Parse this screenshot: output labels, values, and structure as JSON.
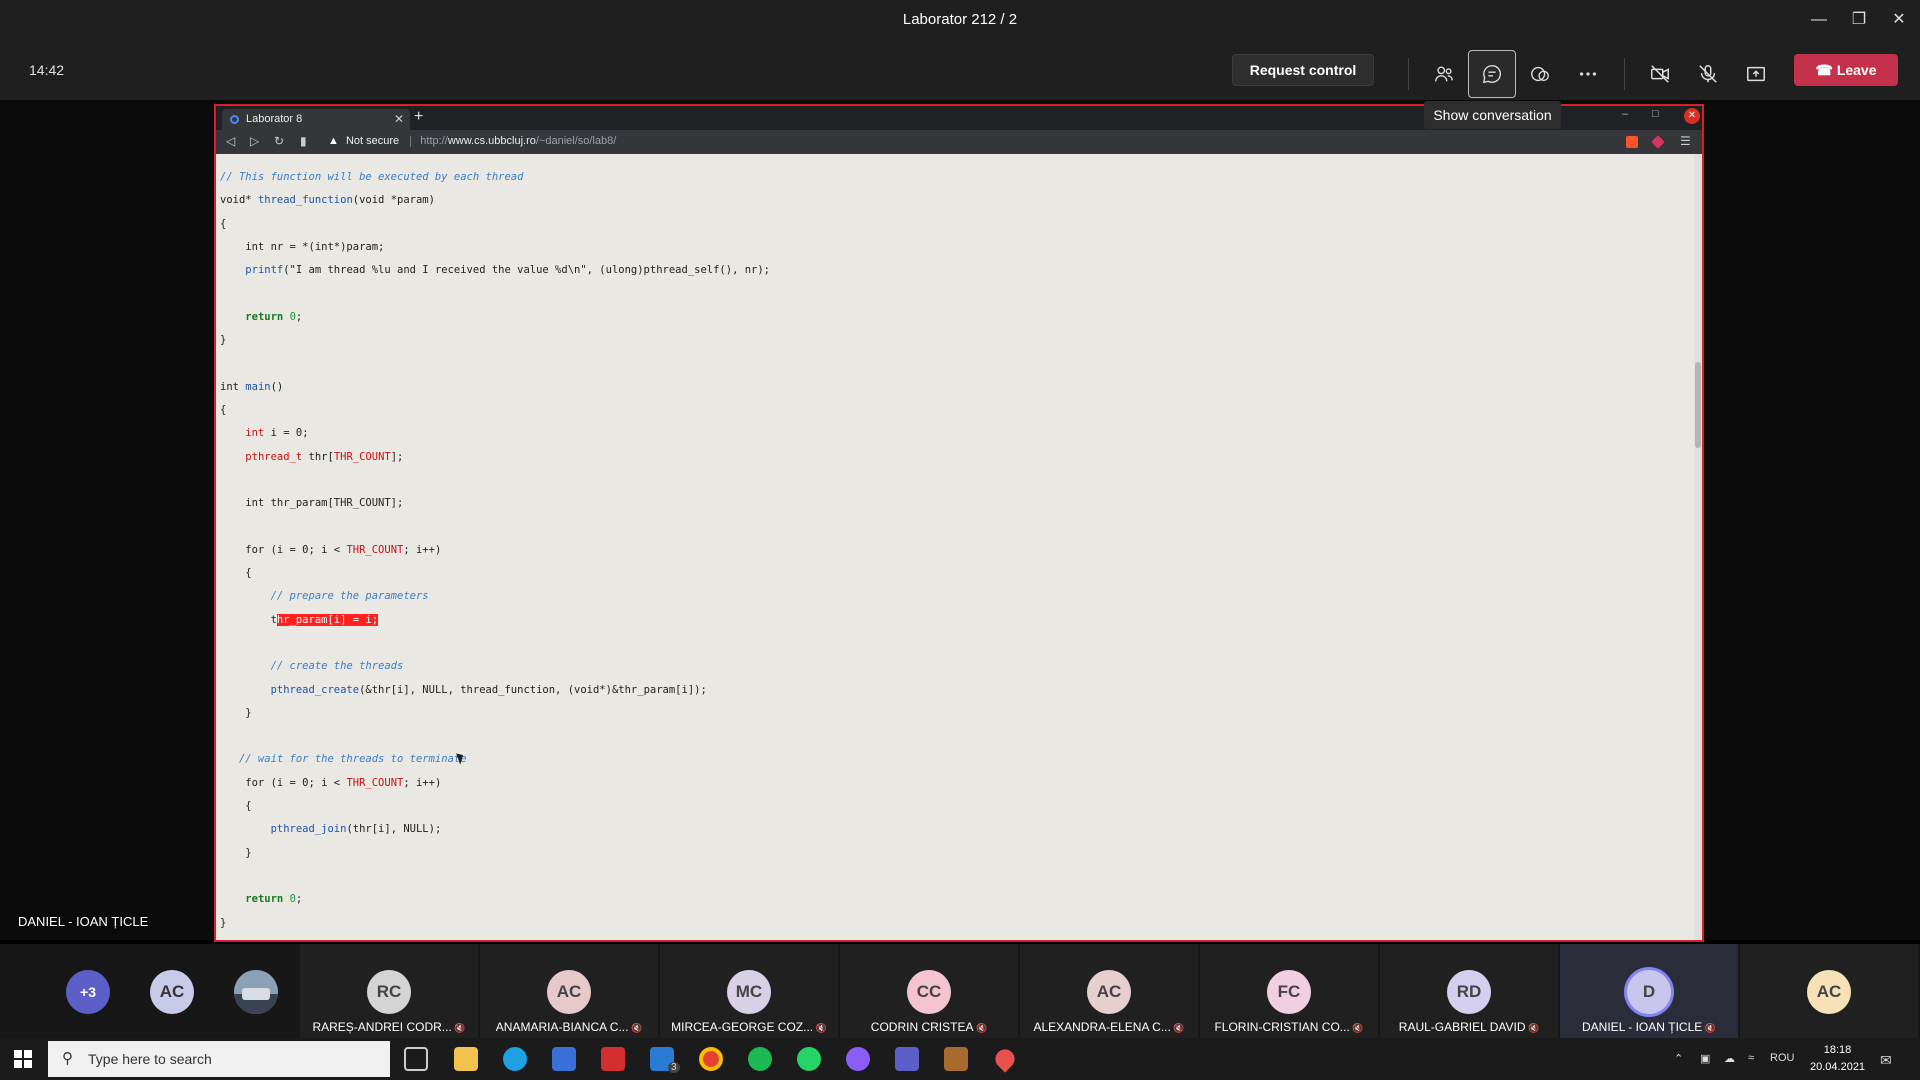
{
  "window": {
    "title": "Laborator 212 / 2"
  },
  "meeting": {
    "timer": "14:42",
    "request_control_label": "Request control",
    "leave_label": "Leave",
    "tooltip": "Show conversation",
    "presenter_name": "DANIEL - IOAN ȚICLE"
  },
  "browser": {
    "tab_title": "Laborator 8",
    "not_secure_label": "Not secure",
    "url_prefix": "http://",
    "url_host": "www.cs.ubbcluj.ro",
    "url_path": "/~daniel/so/lab8/"
  },
  "participants": {
    "overflow_count": "+3",
    "small_avatar_initials": "AC",
    "tiles": [
      {
        "initials": "RC",
        "name": "RAREȘ-ANDREI CODR...",
        "color": "#d4d4d4"
      },
      {
        "initials": "AC",
        "name": "ANAMARIA-BIANCA C...",
        "color": "#e8c9c9"
      },
      {
        "initials": "MC",
        "name": "MIRCEA-GEORGE COZ...",
        "color": "#d7d0e7"
      },
      {
        "initials": "CC",
        "name": "CODRIN CRISTEA",
        "color": "#f4c5d1"
      },
      {
        "initials": "AC",
        "name": "ALEXANDRA-ELENA C...",
        "color": "#e6d0cd"
      },
      {
        "initials": "FC",
        "name": "FLORIN-CRISTIAN CO...",
        "color": "#f2cfe0"
      },
      {
        "initials": "RD",
        "name": "RAUL-GABRIEL DAVID",
        "color": "#d4cfee"
      },
      {
        "initials": "D",
        "name": "DANIEL - IOAN ȚICLE",
        "color": "#c9c6ee"
      },
      {
        "initials": "AC",
        "name": "",
        "color": "#f7e2b8"
      }
    ]
  },
  "taskbar": {
    "search_placeholder": "Type here to search",
    "lang": "ROU",
    "time": "18:18",
    "date": "20.04.2021",
    "mail_badge": "3"
  }
}
